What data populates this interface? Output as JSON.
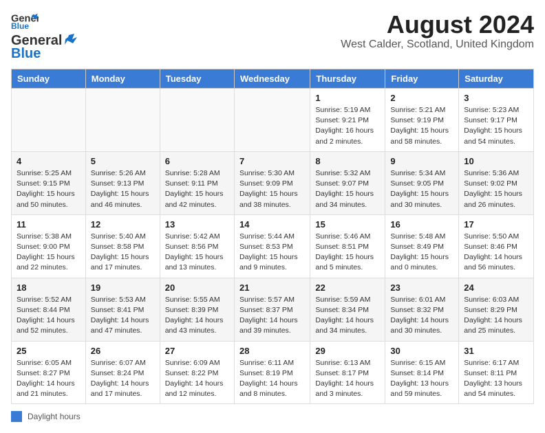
{
  "header": {
    "logo_line1": "General",
    "logo_line2": "Blue",
    "main_title": "August 2024",
    "subtitle": "West Calder, Scotland, United Kingdom"
  },
  "calendar": {
    "headers": [
      "Sunday",
      "Monday",
      "Tuesday",
      "Wednesday",
      "Thursday",
      "Friday",
      "Saturday"
    ],
    "weeks": [
      [
        {
          "day": "",
          "info": ""
        },
        {
          "day": "",
          "info": ""
        },
        {
          "day": "",
          "info": ""
        },
        {
          "day": "",
          "info": ""
        },
        {
          "day": "1",
          "info": "Sunrise: 5:19 AM\nSunset: 9:21 PM\nDaylight: 16 hours\nand 2 minutes."
        },
        {
          "day": "2",
          "info": "Sunrise: 5:21 AM\nSunset: 9:19 PM\nDaylight: 15 hours\nand 58 minutes."
        },
        {
          "day": "3",
          "info": "Sunrise: 5:23 AM\nSunset: 9:17 PM\nDaylight: 15 hours\nand 54 minutes."
        }
      ],
      [
        {
          "day": "4",
          "info": "Sunrise: 5:25 AM\nSunset: 9:15 PM\nDaylight: 15 hours\nand 50 minutes."
        },
        {
          "day": "5",
          "info": "Sunrise: 5:26 AM\nSunset: 9:13 PM\nDaylight: 15 hours\nand 46 minutes."
        },
        {
          "day": "6",
          "info": "Sunrise: 5:28 AM\nSunset: 9:11 PM\nDaylight: 15 hours\nand 42 minutes."
        },
        {
          "day": "7",
          "info": "Sunrise: 5:30 AM\nSunset: 9:09 PM\nDaylight: 15 hours\nand 38 minutes."
        },
        {
          "day": "8",
          "info": "Sunrise: 5:32 AM\nSunset: 9:07 PM\nDaylight: 15 hours\nand 34 minutes."
        },
        {
          "day": "9",
          "info": "Sunrise: 5:34 AM\nSunset: 9:05 PM\nDaylight: 15 hours\nand 30 minutes."
        },
        {
          "day": "10",
          "info": "Sunrise: 5:36 AM\nSunset: 9:02 PM\nDaylight: 15 hours\nand 26 minutes."
        }
      ],
      [
        {
          "day": "11",
          "info": "Sunrise: 5:38 AM\nSunset: 9:00 PM\nDaylight: 15 hours\nand 22 minutes."
        },
        {
          "day": "12",
          "info": "Sunrise: 5:40 AM\nSunset: 8:58 PM\nDaylight: 15 hours\nand 17 minutes."
        },
        {
          "day": "13",
          "info": "Sunrise: 5:42 AM\nSunset: 8:56 PM\nDaylight: 15 hours\nand 13 minutes."
        },
        {
          "day": "14",
          "info": "Sunrise: 5:44 AM\nSunset: 8:53 PM\nDaylight: 15 hours\nand 9 minutes."
        },
        {
          "day": "15",
          "info": "Sunrise: 5:46 AM\nSunset: 8:51 PM\nDaylight: 15 hours\nand 5 minutes."
        },
        {
          "day": "16",
          "info": "Sunrise: 5:48 AM\nSunset: 8:49 PM\nDaylight: 15 hours\nand 0 minutes."
        },
        {
          "day": "17",
          "info": "Sunrise: 5:50 AM\nSunset: 8:46 PM\nDaylight: 14 hours\nand 56 minutes."
        }
      ],
      [
        {
          "day": "18",
          "info": "Sunrise: 5:52 AM\nSunset: 8:44 PM\nDaylight: 14 hours\nand 52 minutes."
        },
        {
          "day": "19",
          "info": "Sunrise: 5:53 AM\nSunset: 8:41 PM\nDaylight: 14 hours\nand 47 minutes."
        },
        {
          "day": "20",
          "info": "Sunrise: 5:55 AM\nSunset: 8:39 PM\nDaylight: 14 hours\nand 43 minutes."
        },
        {
          "day": "21",
          "info": "Sunrise: 5:57 AM\nSunset: 8:37 PM\nDaylight: 14 hours\nand 39 minutes."
        },
        {
          "day": "22",
          "info": "Sunrise: 5:59 AM\nSunset: 8:34 PM\nDaylight: 14 hours\nand 34 minutes."
        },
        {
          "day": "23",
          "info": "Sunrise: 6:01 AM\nSunset: 8:32 PM\nDaylight: 14 hours\nand 30 minutes."
        },
        {
          "day": "24",
          "info": "Sunrise: 6:03 AM\nSunset: 8:29 PM\nDaylight: 14 hours\nand 25 minutes."
        }
      ],
      [
        {
          "day": "25",
          "info": "Sunrise: 6:05 AM\nSunset: 8:27 PM\nDaylight: 14 hours\nand 21 minutes."
        },
        {
          "day": "26",
          "info": "Sunrise: 6:07 AM\nSunset: 8:24 PM\nDaylight: 14 hours\nand 17 minutes."
        },
        {
          "day": "27",
          "info": "Sunrise: 6:09 AM\nSunset: 8:22 PM\nDaylight: 14 hours\nand 12 minutes."
        },
        {
          "day": "28",
          "info": "Sunrise: 6:11 AM\nSunset: 8:19 PM\nDaylight: 14 hours\nand 8 minutes."
        },
        {
          "day": "29",
          "info": "Sunrise: 6:13 AM\nSunset: 8:17 PM\nDaylight: 14 hours\nand 3 minutes."
        },
        {
          "day": "30",
          "info": "Sunrise: 6:15 AM\nSunset: 8:14 PM\nDaylight: 13 hours\nand 59 minutes."
        },
        {
          "day": "31",
          "info": "Sunrise: 6:17 AM\nSunset: 8:11 PM\nDaylight: 13 hours\nand 54 minutes."
        }
      ]
    ]
  },
  "legend": {
    "label": "Daylight hours"
  }
}
